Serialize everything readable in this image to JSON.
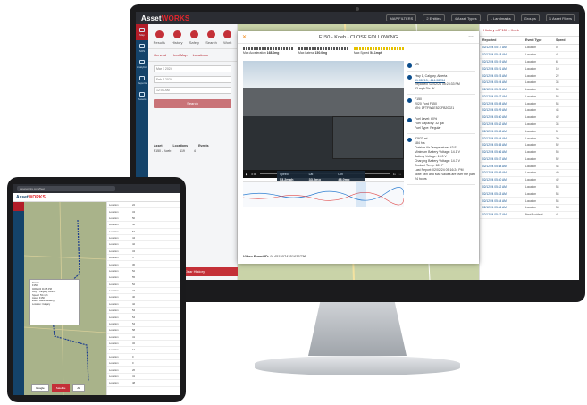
{
  "monitor": {
    "app": {
      "logo_prefix": "Asset",
      "logo_suffix": "WORKS",
      "filters": [
        "MAP FILTERS",
        "2 Entities",
        "4 Asset Types",
        "1 Landmarks",
        "Groups",
        "1 Asset Filters"
      ],
      "sidebar": [
        "Map",
        "SOS",
        "Analytics",
        "Reports",
        "Assets"
      ],
      "left_panel": {
        "tabs": [
          "Results",
          "History",
          "Safety",
          "Search",
          "Work"
        ],
        "subtabs": [
          "General",
          "Heat Map",
          "Locations"
        ],
        "date_from": "Mar 1 2024",
        "date_to": "Feb 5 2024",
        "time_from": "12:00 AM",
        "time_to": "12:00 AM",
        "search_button": "Search",
        "row_headers": [
          "Asset",
          "Locations",
          "Events"
        ],
        "row": [
          "F150 - Koeb",
          "119",
          "4"
        ],
        "bottom_button": "Clear History"
      },
      "right_list": {
        "title": "History of F150 - Koeb",
        "headers": [
          "Reported",
          "Event Type",
          "Speed"
        ],
        "rows": [
          [
            "02/12/24 05:17 AM",
            "Location",
            "0"
          ],
          [
            "02/12/24 05:18 AM",
            "Location",
            "4"
          ],
          [
            "02/12/24 05:19 AM",
            "Location",
            "6"
          ],
          [
            "02/12/24 05:21 AM",
            "Location",
            "10"
          ],
          [
            "02/12/24 05:23 AM",
            "Location",
            "22"
          ],
          [
            "02/12/24 05:24 AM",
            "Location",
            "34"
          ],
          [
            "02/12/24 05:25 AM",
            "Location",
            "50"
          ],
          [
            "02/12/24 05:27 AM",
            "Location",
            "56"
          ],
          [
            "02/12/24 05:28 AM",
            "Location",
            "54"
          ],
          [
            "02/12/24 05:29 AM",
            "Location",
            "44"
          ],
          [
            "02/12/24 05:30 AM",
            "Location",
            "42"
          ],
          [
            "02/12/24 05:32 AM",
            "Location",
            "34"
          ],
          [
            "02/12/24 05:33 AM",
            "Location",
            "5"
          ],
          [
            "02/12/24 05:34 AM",
            "Location",
            "30"
          ],
          [
            "02/12/24 05:35 AM",
            "Location",
            "52"
          ],
          [
            "02/12/24 05:36 AM",
            "Location",
            "55"
          ],
          [
            "02/12/24 05:37 AM",
            "Location",
            "52"
          ],
          [
            "02/12/24 05:38 AM",
            "Location",
            "44"
          ],
          [
            "02/12/24 05:39 AM",
            "Location",
            "40"
          ],
          [
            "02/12/24 05:40 AM",
            "Location",
            "42"
          ],
          [
            "02/12/24 05:42 AM",
            "Location",
            "54"
          ],
          [
            "02/12/24 05:43 AM",
            "Location",
            "54"
          ],
          [
            "02/12/24 05:44 AM",
            "Location",
            "54"
          ],
          [
            "02/12/24 05:46 AM",
            "Location",
            "58"
          ],
          [
            "02/12/24 05:47 AM",
            "Next Accident",
            "41"
          ]
        ]
      }
    },
    "modal": {
      "title": "F150 - Koeb - CLOSE FOLLOWING",
      "gauges": [
        {
          "label": "Max Acceleration",
          "value": "168.0mg"
        },
        {
          "label": "Max Lateral",
          "value": "150.0mg"
        },
        {
          "label": "Max Speed",
          "value": "54.1mph"
        }
      ],
      "overlay": [
        {
          "label": "Speed",
          "value": "53.2mph"
        },
        {
          "label": "Lat",
          "value": "33.0mg"
        },
        {
          "label": "Lon",
          "value": "48.0mg"
        }
      ],
      "video_controls": {
        "time": "0:00",
        "rate": "1x"
      },
      "footer_label": "Video Event ID:",
      "footer_value": "91451507425163673€",
      "info": {
        "location_lines": [
          "Hwy 1, Calgary, Alberta",
          "51.08213, -114.08234",
          "Reported: 02/02/24 05:28:33 PM",
          "53 mph Dir: W"
        ],
        "vehicle_lines": [
          "F150",
          "2020 Ford F150",
          "VIN: 1FTFW1E52KFB20021"
        ],
        "fuel_lines": [
          "Fuel Level: 60%",
          "Fuel Capacity: 32 gal",
          "Fuel Type: Regular"
        ],
        "engine_lines": [
          "82923 mi",
          "184 hrs",
          "Outside Air Temperature: 43 F",
          "Minimum Battery Voltage: 14.1 V",
          "Battery Voltage: 13.3 V",
          "Charging Battery Voltage: 14.3 V",
          "Coolant Temp: 189 F",
          "Last Report: 02/02/24 05:16:24 PM",
          "Note: Min and Max values are over the past 24 hours"
        ],
        "unit_label": "US"
      }
    }
  },
  "tablet": {
    "url": "assetworks.com/fleet",
    "logo_prefix": "Asset",
    "logo_suffix": "WORKS",
    "popup_lines": [
      "Details",
      "F150",
      "02/02/24 01:05 PM",
      "Hwy 1 Calgary, Alberta",
      "Speed: 53 mph",
      "Asset: F150",
      "Event: Harsh Braking",
      "Location: Calgary"
    ],
    "bottom_buttons": [
      "Google",
      "Satellite",
      "All"
    ],
    "rows": [
      [
        "Location",
        "22"
      ],
      [
        "Location",
        "34"
      ],
      [
        "Location",
        "50"
      ],
      [
        "Location",
        "56"
      ],
      [
        "Location",
        "54"
      ],
      [
        "Location",
        "44"
      ],
      [
        "Location",
        "42"
      ],
      [
        "Location",
        "34"
      ],
      [
        "Location",
        "5"
      ],
      [
        "Location",
        "30"
      ],
      [
        "Location",
        "52"
      ],
      [
        "Location",
        "55"
      ],
      [
        "Location",
        "52"
      ],
      [
        "Location",
        "44"
      ],
      [
        "Location",
        "40"
      ],
      [
        "Location",
        "42"
      ],
      [
        "Location",
        "54"
      ],
      [
        "Location",
        "54"
      ],
      [
        "Location",
        "54"
      ],
      [
        "Location",
        "58"
      ],
      [
        "Location",
        "41"
      ],
      [
        "Location",
        "32"
      ],
      [
        "Location",
        "12"
      ],
      [
        "Location",
        "0"
      ],
      [
        "Location",
        "0"
      ],
      [
        "Location",
        "26"
      ],
      [
        "Location",
        "41"
      ],
      [
        "Location",
        "48"
      ]
    ]
  }
}
